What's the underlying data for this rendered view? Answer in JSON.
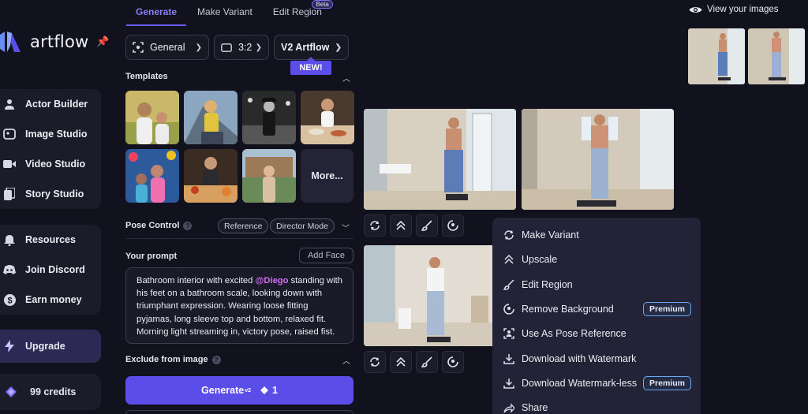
{
  "brand": {
    "name": "artflow"
  },
  "sidebar": {
    "group1": [
      {
        "label": "Actor Builder",
        "icon": "user-icon"
      },
      {
        "label": "Image Studio",
        "icon": "image-icon"
      },
      {
        "label": "Video Studio",
        "icon": "video-icon"
      },
      {
        "label": "Story Studio",
        "icon": "story-icon"
      }
    ],
    "group2": [
      {
        "label": "Resources",
        "icon": "bell-icon"
      },
      {
        "label": "Join Discord",
        "icon": "discord-icon"
      },
      {
        "label": "Earn money",
        "icon": "dollar-icon"
      }
    ],
    "upgrade": "Upgrade",
    "credits": "99 credits"
  },
  "tabs": [
    {
      "label": "Generate",
      "active": true
    },
    {
      "label": "Make Variant",
      "active": false
    },
    {
      "label": "Edit Region",
      "active": false,
      "badge": "Beta"
    }
  ],
  "controls": {
    "style": "General",
    "ratio": "3:2",
    "model": "V2 Artflow",
    "new_badge": "NEW!"
  },
  "templates": {
    "title": "Templates",
    "more": "More..."
  },
  "pose": {
    "title": "Pose Control",
    "reference": "Reference",
    "director": "Director Mode"
  },
  "prompt": {
    "title": "Your prompt",
    "add_face": "Add Face",
    "text_before": "Bathroom interior with excited ",
    "mention": "@Diego",
    "text_after": " standing with his feet on a bathroom scale, looking down with triumphant expression. Wearing loose fitting pyjamas, long sleeve top and bottom, relaxed fit. Morning light streaming in, victory pose, raised fist."
  },
  "exclude": {
    "title": "Exclude from image"
  },
  "generate": {
    "label": "Generate",
    "sup": "v2",
    "cost": "1"
  },
  "view_images": "View your images",
  "menu": {
    "items": [
      {
        "label": "Make Variant",
        "icon": "variant-icon"
      },
      {
        "label": "Upscale",
        "icon": "upscale-icon"
      },
      {
        "label": "Edit Region",
        "icon": "brush-icon"
      },
      {
        "label": "Remove Background",
        "icon": "remove-bg-icon",
        "badge": "Premium"
      },
      {
        "label": "Use As Pose Reference",
        "icon": "pose-icon"
      },
      {
        "label": "Download with Watermark",
        "icon": "download-icon"
      },
      {
        "label": "Download Watermark-less",
        "icon": "download-icon",
        "badge": "Premium"
      },
      {
        "label": "Share",
        "icon": "share-icon"
      }
    ]
  },
  "colors": {
    "accent": "#5b4de8",
    "background": "#12121e",
    "panel": "#1b1b29",
    "menu": "#232337"
  }
}
